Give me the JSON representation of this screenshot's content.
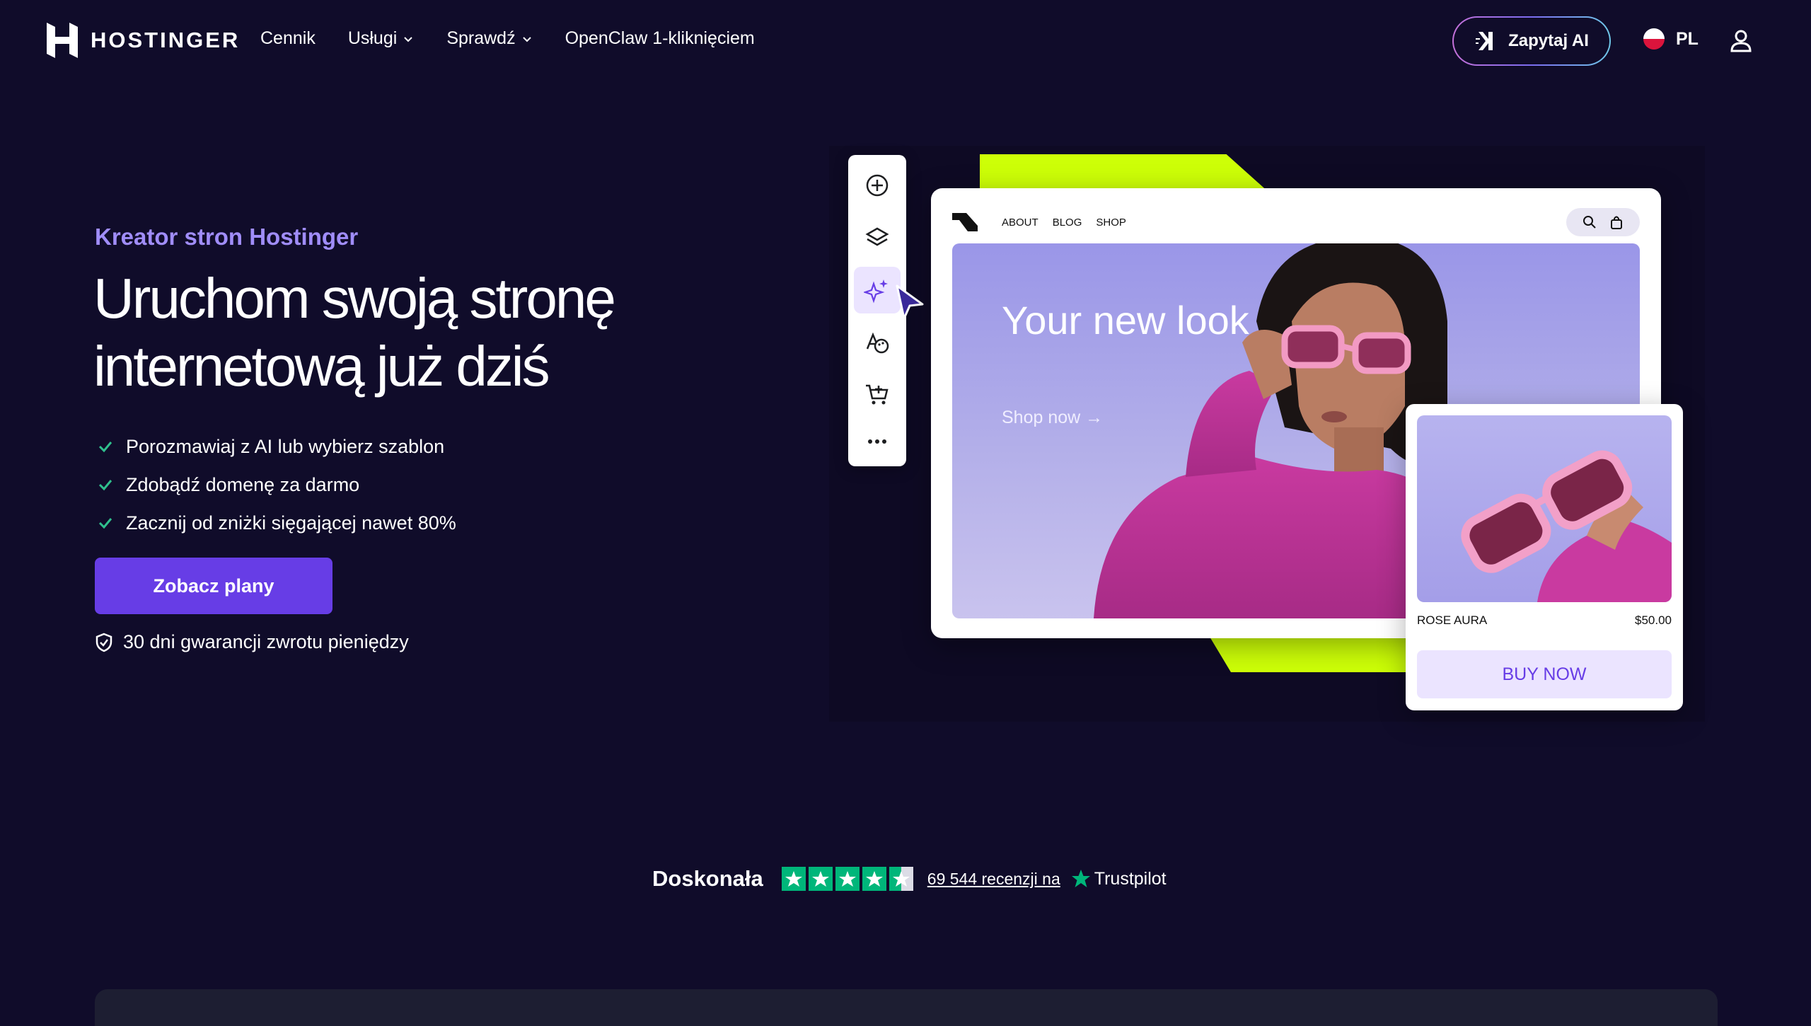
{
  "nav": {
    "logo_text": "HOSTINGER",
    "links": [
      {
        "label": "Cennik",
        "dropdown": false
      },
      {
        "label": "Usługi",
        "dropdown": true
      },
      {
        "label": "Sprawdź",
        "dropdown": true
      },
      {
        "label": "OpenClaw 1-kliknięciem",
        "dropdown": false
      }
    ],
    "ask_ai_label": "Zapytaj AI",
    "language": "PL"
  },
  "hero": {
    "eyebrow": "Kreator stron Hostinger",
    "headline": "Uruchom swoją stronę internetową już dziś",
    "features": [
      "Porozmawiaj z AI lub wybierz szablon",
      "Zdobądź domenę za darmo",
      "Zacznij od zniżki sięgającej nawet 80%"
    ],
    "cta_label": "Zobacz plany",
    "guarantee": "30 dni gwarancji zwrotu pieniędzy"
  },
  "mockup": {
    "site_nav": [
      "ABOUT",
      "BLOG",
      "SHOP"
    ],
    "hero_title": "Your new look",
    "hero_link": "Shop now →",
    "product_name": "ROSE AURA",
    "product_price": "$50.00",
    "buy_label": "BUY NOW",
    "toolbar_icons": [
      "add-icon",
      "layers-icon",
      "ai-sparkle-icon",
      "design-palette-icon",
      "ecommerce-cart-icon",
      "more-icon"
    ]
  },
  "rating": {
    "label": "Doskonała",
    "stars": 4.5,
    "reviews_text": "69 544 recenzji na",
    "provider": "Trustpilot"
  },
  "colors": {
    "background": "#100c2a",
    "accent": "#673de6",
    "eyebrow": "#a08df9",
    "lime": "#cdff07",
    "trustpilot_green": "#00b67a"
  }
}
